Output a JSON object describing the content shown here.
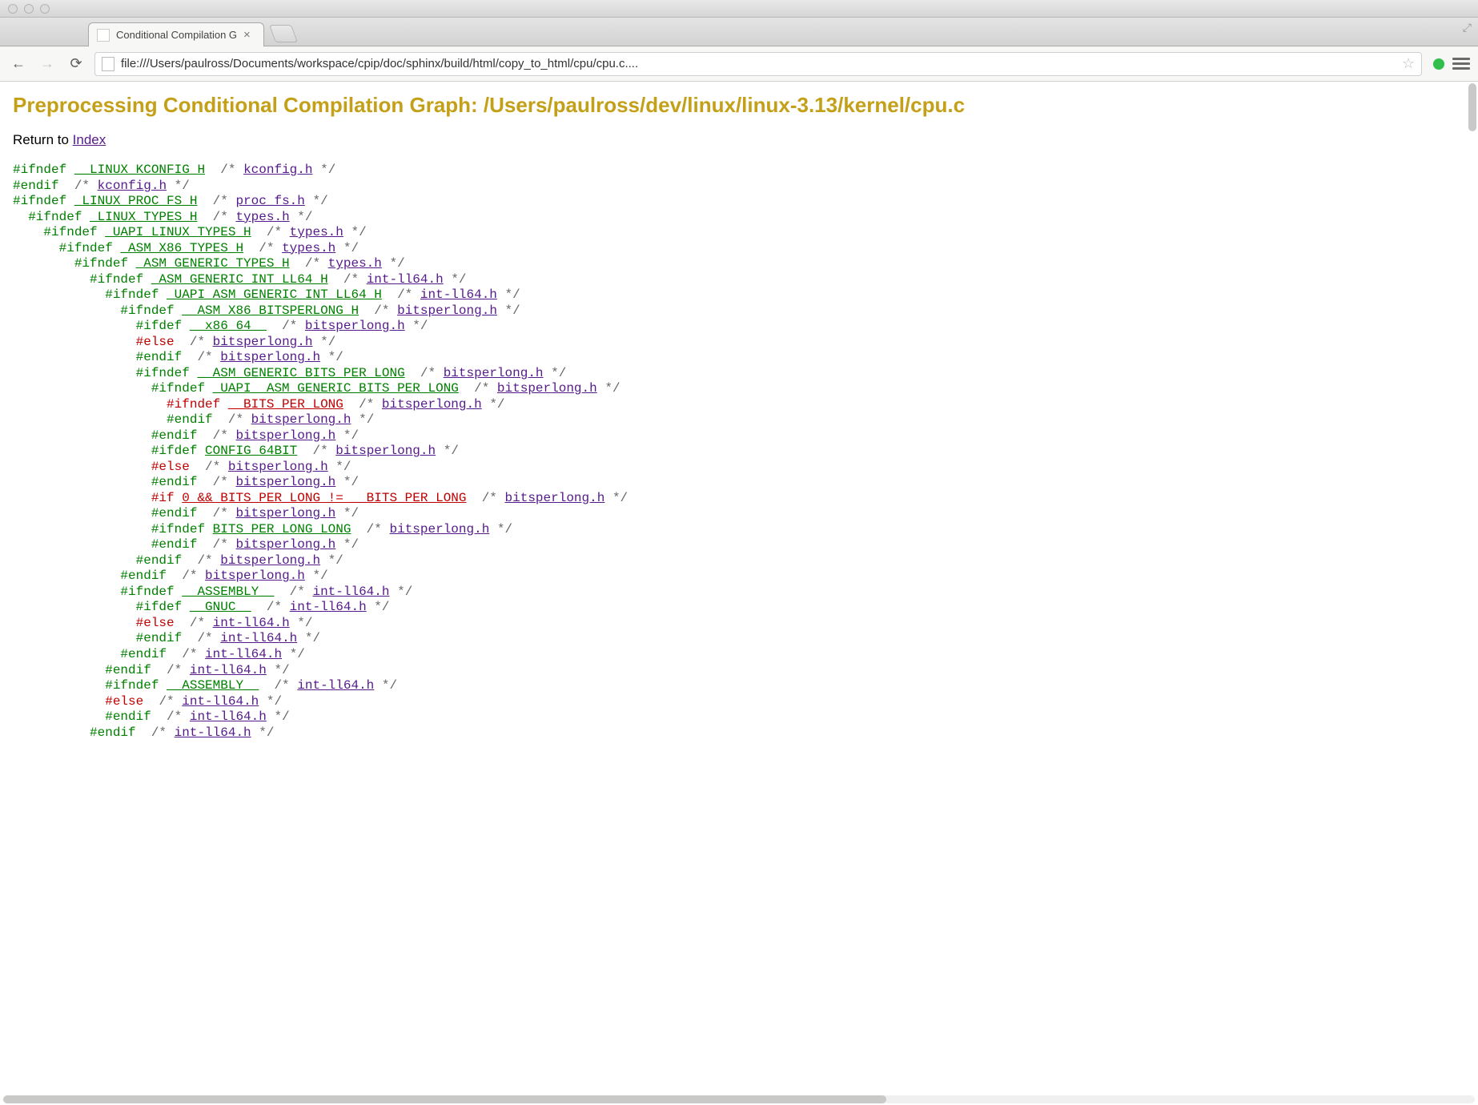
{
  "window": {
    "tab_title": "Conditional Compilation G",
    "url": "file:///Users/paulross/Documents/workspace/cpip/doc/sphinx/build/html/copy_to_html/cpu/cpu.c...."
  },
  "page": {
    "heading": "Preprocessing Conditional Compilation Graph: /Users/paulross/dev/linux/linux-3.13/kernel/cpu.c",
    "return_prefix": "Return to ",
    "return_link": "Index"
  },
  "code_lines": [
    {
      "indent": 0,
      "color": "green",
      "dir": "#ifndef",
      "macro": "__LINUX_KCONFIG_H",
      "link": "kconfig.h"
    },
    {
      "indent": 0,
      "color": "green",
      "dir": "#endif",
      "macro": "",
      "link": "kconfig.h"
    },
    {
      "indent": 0,
      "color": "green",
      "dir": "#ifndef",
      "macro": "_LINUX_PROC_FS_H",
      "link": "proc_fs.h"
    },
    {
      "indent": 1,
      "color": "green",
      "dir": "#ifndef",
      "macro": "_LINUX_TYPES_H",
      "link": "types.h"
    },
    {
      "indent": 2,
      "color": "green",
      "dir": "#ifndef",
      "macro": "_UAPI_LINUX_TYPES_H",
      "link": "types.h"
    },
    {
      "indent": 3,
      "color": "green",
      "dir": "#ifndef",
      "macro": "_ASM_X86_TYPES_H",
      "link": "types.h"
    },
    {
      "indent": 4,
      "color": "green",
      "dir": "#ifndef",
      "macro": "_ASM_GENERIC_TYPES_H",
      "link": "types.h"
    },
    {
      "indent": 5,
      "color": "green",
      "dir": "#ifndef",
      "macro": "_ASM_GENERIC_INT_LL64_H",
      "link": "int-ll64.h"
    },
    {
      "indent": 6,
      "color": "green",
      "dir": "#ifndef",
      "macro": "_UAPI_ASM_GENERIC_INT_LL64_H",
      "link": "int-ll64.h"
    },
    {
      "indent": 7,
      "color": "green",
      "dir": "#ifndef",
      "macro": "__ASM_X86_BITSPERLONG_H",
      "link": "bitsperlong.h"
    },
    {
      "indent": 8,
      "color": "green",
      "dir": "#ifdef",
      "macro": "__x86_64__",
      "link": "bitsperlong.h"
    },
    {
      "indent": 8,
      "color": "red",
      "dir": "#else",
      "macro": "",
      "link": "bitsperlong.h"
    },
    {
      "indent": 8,
      "color": "green",
      "dir": "#endif",
      "macro": "",
      "link": "bitsperlong.h"
    },
    {
      "indent": 8,
      "color": "green",
      "dir": "#ifndef",
      "macro": "__ASM_GENERIC_BITS_PER_LONG",
      "link": "bitsperlong.h"
    },
    {
      "indent": 9,
      "color": "green",
      "dir": "#ifndef",
      "macro": "_UAPI__ASM_GENERIC_BITS_PER_LONG",
      "link": "bitsperlong.h"
    },
    {
      "indent": 10,
      "color": "red",
      "dir": "#ifndef",
      "macro": "__BITS_PER_LONG",
      "link": "bitsperlong.h"
    },
    {
      "indent": 10,
      "color": "green",
      "dir": "#endif",
      "macro": "",
      "link": "bitsperlong.h"
    },
    {
      "indent": 9,
      "color": "green",
      "dir": "#endif",
      "macro": "",
      "link": "bitsperlong.h"
    },
    {
      "indent": 9,
      "color": "green",
      "dir": "#ifdef",
      "macro": "CONFIG_64BIT",
      "link": "bitsperlong.h"
    },
    {
      "indent": 9,
      "color": "red",
      "dir": "#else",
      "macro": "",
      "link": "bitsperlong.h"
    },
    {
      "indent": 9,
      "color": "green",
      "dir": "#endif",
      "macro": "",
      "link": "bitsperlong.h"
    },
    {
      "indent": 9,
      "color": "red",
      "dir": "#if",
      "macro": "0 && BITS_PER_LONG != __BITS_PER_LONG",
      "link": "bitsperlong.h"
    },
    {
      "indent": 9,
      "color": "green",
      "dir": "#endif",
      "macro": "",
      "link": "bitsperlong.h"
    },
    {
      "indent": 9,
      "color": "green",
      "dir": "#ifndef",
      "macro": "BITS_PER_LONG_LONG",
      "link": "bitsperlong.h"
    },
    {
      "indent": 9,
      "color": "green",
      "dir": "#endif",
      "macro": "",
      "link": "bitsperlong.h"
    },
    {
      "indent": 8,
      "color": "green",
      "dir": "#endif",
      "macro": "",
      "link": "bitsperlong.h"
    },
    {
      "indent": 7,
      "color": "green",
      "dir": "#endif",
      "macro": "",
      "link": "bitsperlong.h"
    },
    {
      "indent": 7,
      "color": "green",
      "dir": "#ifndef",
      "macro": "__ASSEMBLY__",
      "link": "int-ll64.h"
    },
    {
      "indent": 8,
      "color": "green",
      "dir": "#ifdef",
      "macro": "__GNUC__",
      "link": "int-ll64.h"
    },
    {
      "indent": 8,
      "color": "red",
      "dir": "#else",
      "macro": "",
      "link": "int-ll64.h"
    },
    {
      "indent": 8,
      "color": "green",
      "dir": "#endif",
      "macro": "",
      "link": "int-ll64.h"
    },
    {
      "indent": 7,
      "color": "green",
      "dir": "#endif",
      "macro": "",
      "link": "int-ll64.h"
    },
    {
      "indent": 6,
      "color": "green",
      "dir": "#endif",
      "macro": "",
      "link": "int-ll64.h"
    },
    {
      "indent": 6,
      "color": "green",
      "dir": "#ifndef",
      "macro": "__ASSEMBLY__",
      "link": "int-ll64.h"
    },
    {
      "indent": 6,
      "color": "red",
      "dir": "#else",
      "macro": "",
      "link": "int-ll64.h"
    },
    {
      "indent": 6,
      "color": "green",
      "dir": "#endif",
      "macro": "",
      "link": "int-ll64.h"
    },
    {
      "indent": 5,
      "color": "green",
      "dir": "#endif",
      "macro": "",
      "link": "int-ll64.h"
    }
  ]
}
